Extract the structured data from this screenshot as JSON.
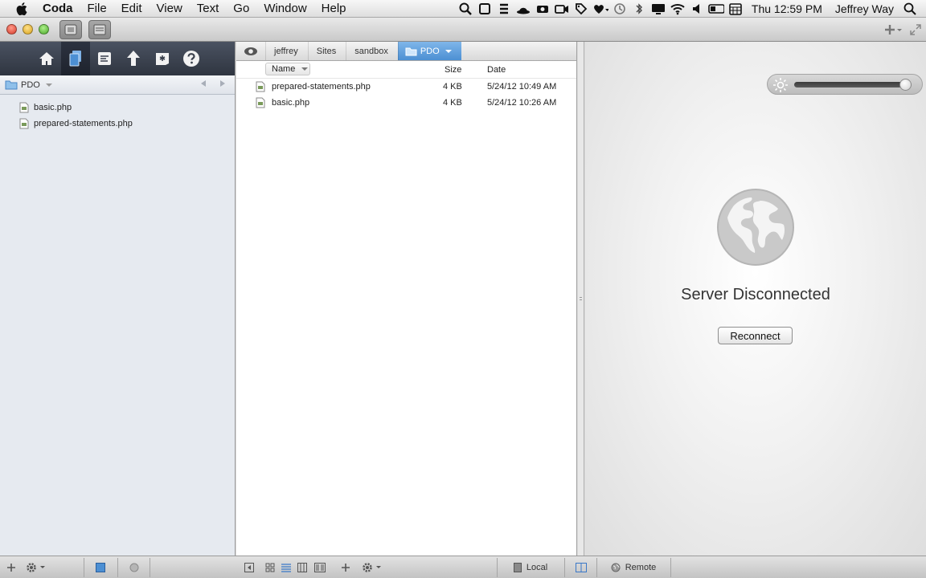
{
  "menubar": {
    "items": [
      "Coda",
      "File",
      "Edit",
      "View",
      "Text",
      "Go",
      "Window",
      "Help"
    ],
    "clock": "Thu 12:59 PM",
    "user": "Jeffrey Way"
  },
  "sidebar": {
    "folder": "PDO",
    "files": [
      "basic.php",
      "prepared-statements.php"
    ]
  },
  "browser": {
    "breadcrumbs": [
      "jeffrey",
      "Sites",
      "sandbox"
    ],
    "current_folder": "PDO",
    "columns": {
      "name": "Name",
      "size": "Size",
      "date": "Date"
    },
    "files": [
      {
        "name": "prepared-statements.php",
        "size": "4 KB",
        "date": "5/24/12 10:49 AM"
      },
      {
        "name": "basic.php",
        "size": "4 KB",
        "date": "5/24/12 10:26 AM"
      }
    ]
  },
  "preview": {
    "status": "Server Disconnected",
    "reconnect_label": "Reconnect",
    "brightness": 0.95
  },
  "bottombar": {
    "local_label": "Local",
    "remote_label": "Remote"
  },
  "colors": {
    "accent_blue": "#4c8fd3",
    "sidebar_tabs_bg": "#2f3540"
  }
}
